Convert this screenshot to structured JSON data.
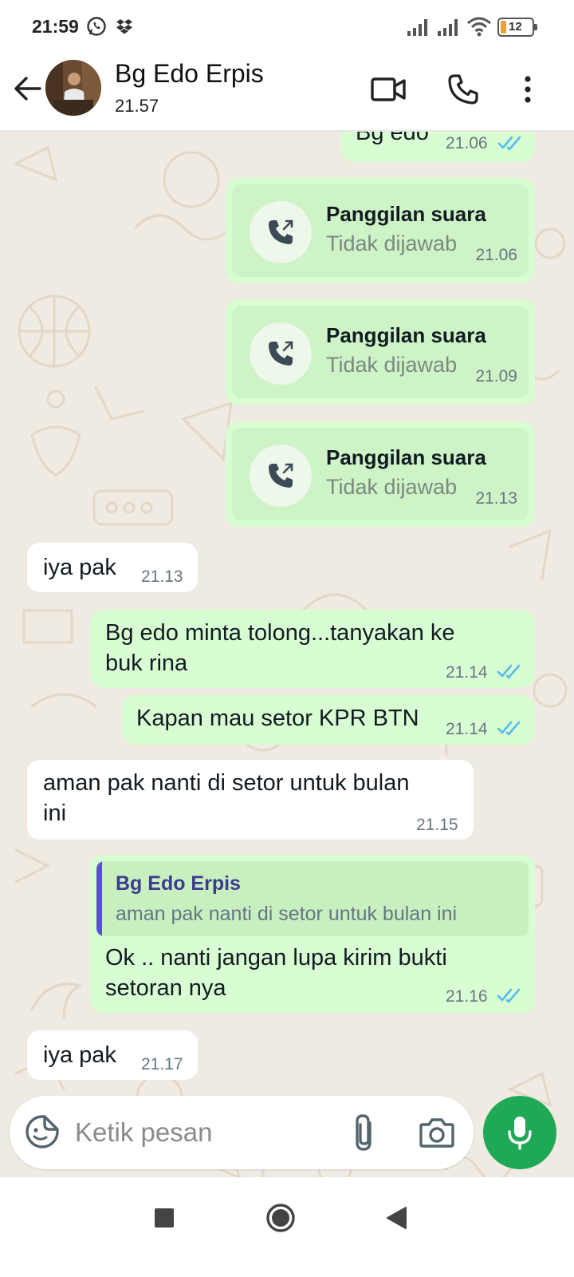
{
  "status_bar": {
    "time": "21:59",
    "battery": "12"
  },
  "header": {
    "contact_name": "Bg Edo Erpis",
    "last_seen": "21.57",
    "icons": [
      "back-arrow-icon",
      "video-call-icon",
      "voice-call-icon",
      "more-vert-icon"
    ]
  },
  "messages": [
    {
      "type": "text",
      "dir": "out",
      "text": "Bg edo",
      "time": "21.06",
      "read": true
    },
    {
      "type": "call",
      "dir": "out",
      "title": "Panggilan suara",
      "status": "Tidak dijawab",
      "time": "21.06"
    },
    {
      "type": "call",
      "dir": "out",
      "title": "Panggilan suara",
      "status": "Tidak dijawab",
      "time": "21.09"
    },
    {
      "type": "call",
      "dir": "out",
      "title": "Panggilan suara",
      "status": "Tidak dijawab",
      "time": "21.13"
    },
    {
      "type": "text",
      "dir": "in",
      "text": "iya pak",
      "time": "21.13"
    },
    {
      "type": "text",
      "dir": "out",
      "lines": [
        "Bg edo minta tolong...tanyakan ke",
        "buk rina"
      ],
      "time": "21.14",
      "read": true
    },
    {
      "type": "text",
      "dir": "out",
      "text": "Kapan mau setor KPR BTN",
      "time": "21.14",
      "read": true
    },
    {
      "type": "text",
      "dir": "in",
      "lines": [
        "aman pak nanti di setor untuk bulan",
        "ini"
      ],
      "time": "21.15"
    },
    {
      "type": "reply",
      "dir": "out",
      "quote_name": "Bg Edo Erpis",
      "quote_text": "aman pak nanti di setor untuk bulan ini",
      "lines": [
        "Ok .. nanti jangan lupa kirim bukti",
        "setoran nya"
      ],
      "time": "21.16",
      "read": true
    },
    {
      "type": "text",
      "dir": "in",
      "text": "iya pak",
      "time": "21.17"
    }
  ],
  "input": {
    "placeholder": "Ketik pesan"
  },
  "colors": {
    "outgoing_bubble": "#d9fdd3",
    "incoming_bubble": "#ffffff",
    "chat_bg": "#efeae2",
    "read_ticks": "#53bdeb",
    "mic_button": "#1fa855",
    "quote_bar": "#5b4fd6"
  }
}
